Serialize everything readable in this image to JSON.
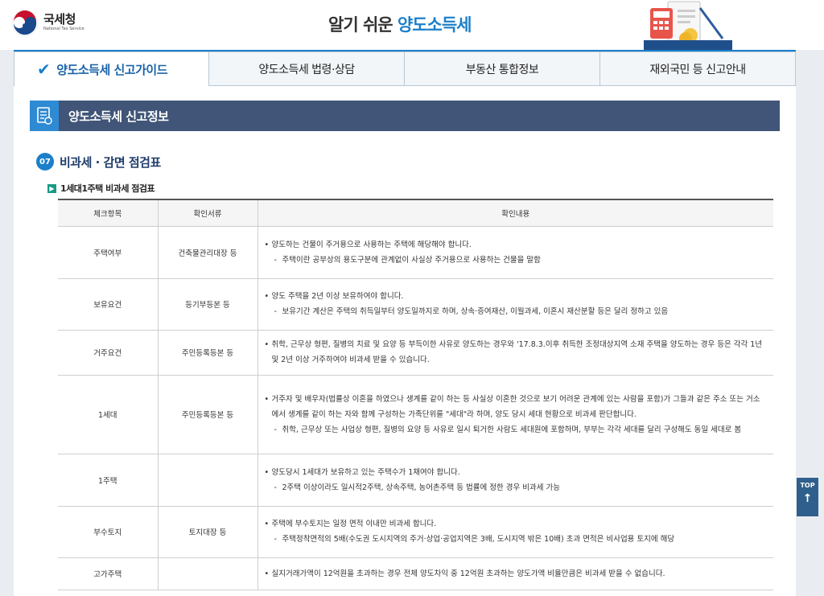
{
  "header": {
    "logo_text": "국세청",
    "logo_sub": "National Tax Service",
    "title_prefix": "알기 쉬운 ",
    "title_highlight": "양도소득세"
  },
  "tabs": [
    {
      "label": "양도소득세 신고가이드",
      "active": true
    },
    {
      "label": "양도소득세 법령·상담",
      "active": false
    },
    {
      "label": "부동산 통합정보",
      "active": false
    },
    {
      "label": "재외국민 등 신고안내",
      "active": false
    }
  ],
  "section": {
    "title": "양도소득세 신고정보"
  },
  "step": {
    "number": "07",
    "title": "비과세 · 감면 점검표"
  },
  "subsection": {
    "title": "1세대1주택 비과세 점검표"
  },
  "table": {
    "headers": [
      "체크항목",
      "확인서류",
      "확인내용"
    ],
    "rows": [
      {
        "item": "주택여부",
        "doc": "건축물관리대장 등",
        "main": "양도하는 건물이 주거용으로 사용하는 주택에 해당해야 합니다.",
        "sub": "주택이란 공부상의 용도구분에 관계없이 사실상 주거용으로 사용하는 건물을 말함"
      },
      {
        "item": "보유요건",
        "doc": "등기부등본 등",
        "main": "양도 주택을 2년 이상 보유하여야 합니다.",
        "sub": "보유기간 계산은 주택의 취득일부터 양도일까지로 하며, 상속·증여재산, 이월과세, 이혼시 재산분할 등은 달리 정하고 있음"
      },
      {
        "item": "거주요건",
        "doc": "주민등록등본 등",
        "main": "취학, 근무상 형편, 질병의 치료 및 요양 등 부득이한 사유로 양도하는 경우와 '17.8.3.이후 취득한 조정대상지역 소재 주택을 양도하는 경우 등은 각각 1년 및 2년 이상 거주하여야 비과세 받을 수 있습니다.",
        "sub": ""
      },
      {
        "item": "1세대",
        "doc": "주민등록등본 등",
        "main": "거주자 및 배우자(법률상 이혼을 하였으나 생계를 같이 하는 등 사실상 이혼한 것으로 보기 어려운 관계에 있는 사람을 포함)가 그들과 같은 주소 또는 거소에서 생계를 같이 하는 자와 함께 구성하는 가족단위를 \"세대\"라 하며, 양도 당시 세대 현황으로 비과세 판단합니다.",
        "sub": "취학, 근무상 또는 사업상 형편, 질병의 요양 등 사유로 일시 퇴거한 사람도 세대원에 포함하며, 부부는 각각 세대를 달리 구성해도 동일 세대로 봄"
      },
      {
        "item": "1주택",
        "doc": "",
        "main": "양도당시 1세대가 보유하고 있는 주택수가 1채여야 합니다.",
        "sub": "2주택 이상이라도 일시적2주택, 상속주택, 농어촌주택 등 법률에 정한 경우 비과세 가능"
      },
      {
        "item": "부수토지",
        "doc": "토지대장 등",
        "main": "주택에 부수토지는 일정 면적 이내만 비과세 합니다.",
        "sub": "주택정착면적의 5배(수도권 도시지역의 주거·상업·공업지역은 3배, 도시지역 밖은 10배) 초과 면적은 비사업용 토지에 해당"
      },
      {
        "item": "고가주택",
        "doc": "",
        "main": "실지거래가액이 12억원을 초과하는 경우 전체 양도차익 중 12억원 초과하는 양도가액 비율만큼은 비과세 받을 수 없습니다.",
        "sub": ""
      }
    ]
  },
  "top_button": {
    "label": "TOP",
    "arrow": "↑"
  }
}
